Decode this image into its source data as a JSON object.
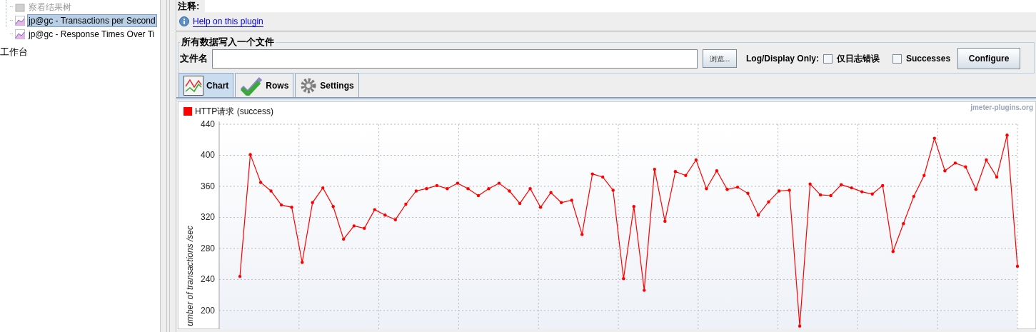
{
  "tree": {
    "items": [
      {
        "label": "察看结果树",
        "selected": false
      },
      {
        "label": "jp@gc - Transactions per Second",
        "selected": true
      },
      {
        "label": "jp@gc - Response Times Over Ti",
        "selected": false
      }
    ],
    "workbench": {
      "label": "工作台"
    }
  },
  "comment": {
    "label": "注释:"
  },
  "help_link": "Help on this plugin",
  "file_group": {
    "title": "所有数据写入一个文件",
    "filename_label": "文件名",
    "browse_button": "浏览...",
    "log_display_label": "Log/Display Only:",
    "checkboxes": [
      {
        "label": "仅日志错误",
        "checked": false
      },
      {
        "label": "Successes",
        "checked": false
      }
    ],
    "configure_button": "Configure"
  },
  "tabs": [
    {
      "label": "Chart",
      "selected": true
    },
    {
      "label": "Rows",
      "selected": false
    },
    {
      "label": "Settings",
      "selected": false
    }
  ],
  "chart": {
    "watermark": "jmeter-plugins.org",
    "chart_data": {
      "type": "line",
      "grid": true,
      "categories": [
        null,
        null,
        null,
        null,
        null,
        null,
        null,
        null,
        null,
        null,
        null,
        null,
        null,
        null,
        null,
        null,
        null,
        null,
        null,
        null,
        null,
        null,
        null,
        null,
        null,
        null,
        null,
        null,
        null,
        null,
        null,
        null,
        null,
        null,
        null,
        null,
        null,
        null,
        null,
        null,
        null,
        null,
        null,
        null,
        null,
        null,
        null,
        null,
        null,
        null,
        null,
        null,
        null,
        null,
        null,
        null,
        null,
        null,
        null,
        null,
        null,
        null,
        null,
        null,
        null,
        null,
        null,
        null,
        null,
        null,
        null,
        null,
        null,
        null,
        null,
        null
      ],
      "ylabel": "umber of transactions /sec",
      "ylim": [
        176,
        440
      ],
      "yticks": [
        200,
        240,
        280,
        320,
        360,
        400,
        440
      ],
      "series": [
        {
          "name": "HTTP请求 (success)",
          "color": "#ff0000",
          "values": [
            244,
            401,
            365,
            354,
            336,
            333,
            262,
            339,
            358,
            334,
            292,
            309,
            306,
            330,
            323,
            317,
            337,
            354,
            357,
            361,
            357,
            364,
            357,
            348,
            357,
            364,
            354,
            338,
            357,
            333,
            352,
            339,
            342,
            298,
            376,
            372,
            355,
            241,
            334,
            226,
            382,
            315,
            379,
            374,
            394,
            357,
            380,
            356,
            359,
            351,
            323,
            340,
            354,
            355,
            180,
            363,
            349,
            348,
            362,
            358,
            353,
            350,
            361,
            276,
            312,
            347,
            374,
            422,
            380,
            390,
            385,
            356,
            394,
            372,
            426,
            257
          ]
        }
      ]
    }
  }
}
